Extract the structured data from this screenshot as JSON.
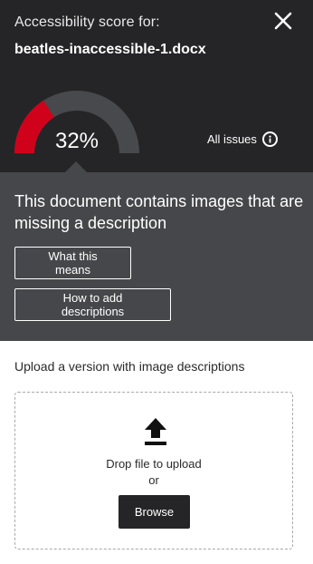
{
  "header": {
    "score_label": "Accessibility score for:",
    "filename": "beatles-inaccessible-1.docx",
    "close_icon": "close-icon"
  },
  "score": {
    "percent_text": "32%",
    "fraction": 0.32,
    "fill_color": "#d0021b",
    "track_color": "#48494d"
  },
  "all_issues": {
    "label": "All issues",
    "icon": "info-icon"
  },
  "message": {
    "text": "This document contains images that are missing a description",
    "what_this_means_label": "What this means",
    "how_to_add_label": "How to add descriptions"
  },
  "upload": {
    "title": "Upload a version with image descriptions",
    "icon": "upload-icon",
    "drop_text": "Drop file to upload",
    "or_text": "or",
    "browse_label": "Browse"
  },
  "colors": {
    "header_bg": "#252527",
    "band_bg": "#46474b",
    "accent": "#d0021b"
  }
}
